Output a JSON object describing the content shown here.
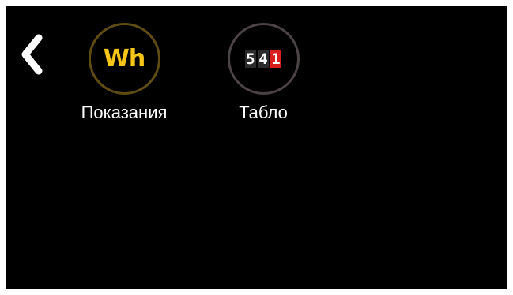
{
  "nav": {
    "back_icon": "chevron-left-icon"
  },
  "tiles": [
    {
      "icon": "wh-icon",
      "icon_text": "Wh",
      "icon_color": "#f5c518",
      "label": "Показания"
    },
    {
      "icon": "counter-display-icon",
      "digits": [
        "5",
        "4",
        "1"
      ],
      "highlight_digit_color": "#d91e1e",
      "label": "Табло"
    }
  ]
}
